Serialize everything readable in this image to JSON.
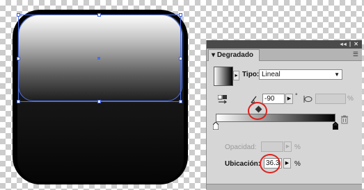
{
  "panel": {
    "window_controls": "◂◂ | ✕",
    "tab_label": "Degradado",
    "tab_arrow": "▾",
    "menu_icon": "☰",
    "type_label": "Tipo:",
    "type_value": "Lineal",
    "angle_value": "-90",
    "degree_symbol": "°",
    "aspect_value": "",
    "aspect_unit": "%",
    "opacity_label": "Opacidad:",
    "opacity_value": "",
    "opacity_unit": "%",
    "location_label": "Ubicación:",
    "location_value": "36.3",
    "location_unit": "%"
  },
  "gradient": {
    "start_color": "#ffffff",
    "end_color": "#000000",
    "midpoint_percent": 36.3
  },
  "colors": {
    "selection": "#4a6ee8",
    "highlight": "#e0201a",
    "panel_bg": "#d6d6d6"
  }
}
